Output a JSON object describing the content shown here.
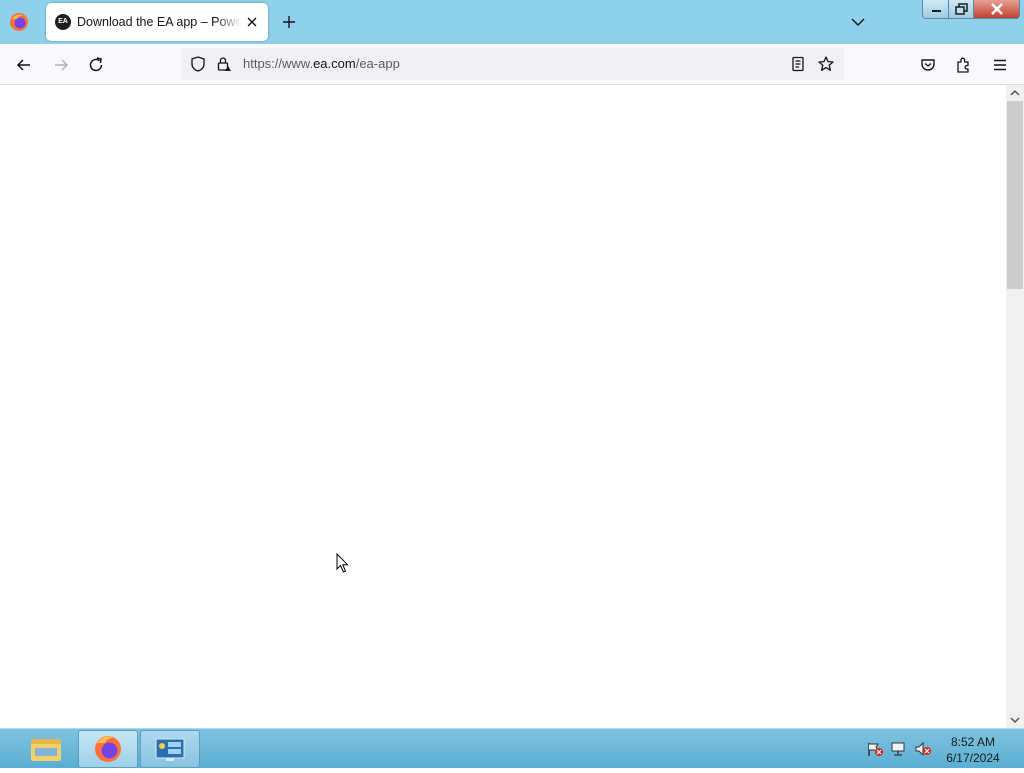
{
  "browser": {
    "tab": {
      "title": "Download the EA app – Powered by EA",
      "favicon_text": "EA",
      "favicon": "ea-logo-icon"
    },
    "url": {
      "prefix": "https://www.",
      "host": "ea.com",
      "path": "/ea-app"
    },
    "icons": {
      "menu": "firefox-icon",
      "close_tab": "close-icon",
      "new_tab": "plus-icon",
      "tab_list": "chevron-down-icon",
      "back": "arrow-left-icon",
      "forward": "arrow-right-icon",
      "reload": "reload-icon",
      "tracking": "shield-icon",
      "security": "lock-icon",
      "reader": "reader-view-icon",
      "bookmark": "star-icon",
      "pocket": "pocket-icon",
      "extensions": "puzzle-icon",
      "app_menu": "hamburger-icon"
    }
  },
  "taskbar": {
    "apps": [
      "file-explorer-icon",
      "firefox-icon",
      "server-manager-icon"
    ],
    "tray": [
      "action-center-flag-icon",
      "network-icon",
      "volume-muted-icon"
    ],
    "clock": {
      "time": "8:52 AM",
      "date": "6/17/2024"
    }
  },
  "colors": {
    "titlebar": "#8fd0ea",
    "toolbar": "#f9f9fb",
    "urlbar": "#f0f0f4",
    "taskbar": "#6cb9da",
    "close_button": "#c2412f"
  }
}
